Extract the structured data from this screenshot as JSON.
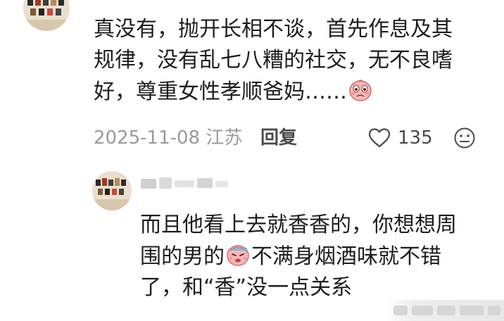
{
  "comments": [
    {
      "text_lines": [
        "真没有，抛开长相不谈，首先作息及其",
        "规律，没有乱七八糟的社交，无不良嗜",
        "好，尊重女性孝顺爸妈……"
      ],
      "date_location": "2025-11-08 江苏",
      "reply_label": "回复",
      "like_count": "135"
    },
    {
      "text_lines": [
        "而且他看上去就香香的，你想想周",
        "围的男的",
        "不满身烟酒味就不错",
        "了，和“香”没一点关系"
      ]
    }
  ],
  "icons": {
    "emoji_1": "crying-face-emoji",
    "emoji_2": "sweating-face-emoji",
    "like": "heart-outline-icon",
    "more": "face-neutral-icon"
  },
  "colors": {
    "text": "#1d1d1d",
    "meta": "#9a9a9a",
    "action": "#4a4a4a",
    "emoji_pink": "#f7b8b8"
  }
}
